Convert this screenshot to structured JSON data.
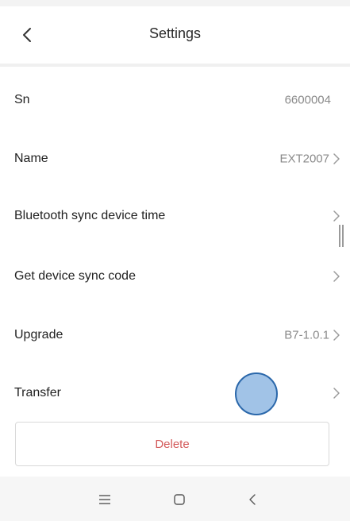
{
  "header": {
    "title": "Settings",
    "back_icon": "chevron-left-icon"
  },
  "rows": [
    {
      "label": "Sn",
      "value": "6600004",
      "has_chevron": false
    },
    {
      "label": "Name",
      "value": "EXT2007",
      "has_chevron": true
    },
    {
      "label": "Bluetooth sync device time",
      "value": "",
      "has_chevron": true
    },
    {
      "label": "Get device sync code",
      "value": "",
      "has_chevron": true
    },
    {
      "label": "Upgrade",
      "value": "B7-1.0.1",
      "has_chevron": true
    },
    {
      "label": "Transfer",
      "value": "",
      "has_chevron": true
    }
  ],
  "delete_button": {
    "label": "Delete",
    "color": "#d35a5a"
  },
  "nav_bar": {
    "icons": [
      "menu-icon",
      "home-icon",
      "back-icon"
    ]
  },
  "colors": {
    "label_text": "#222222",
    "value_text": "#8a8a8a",
    "touch_indicator": "#9cc0e6"
  }
}
